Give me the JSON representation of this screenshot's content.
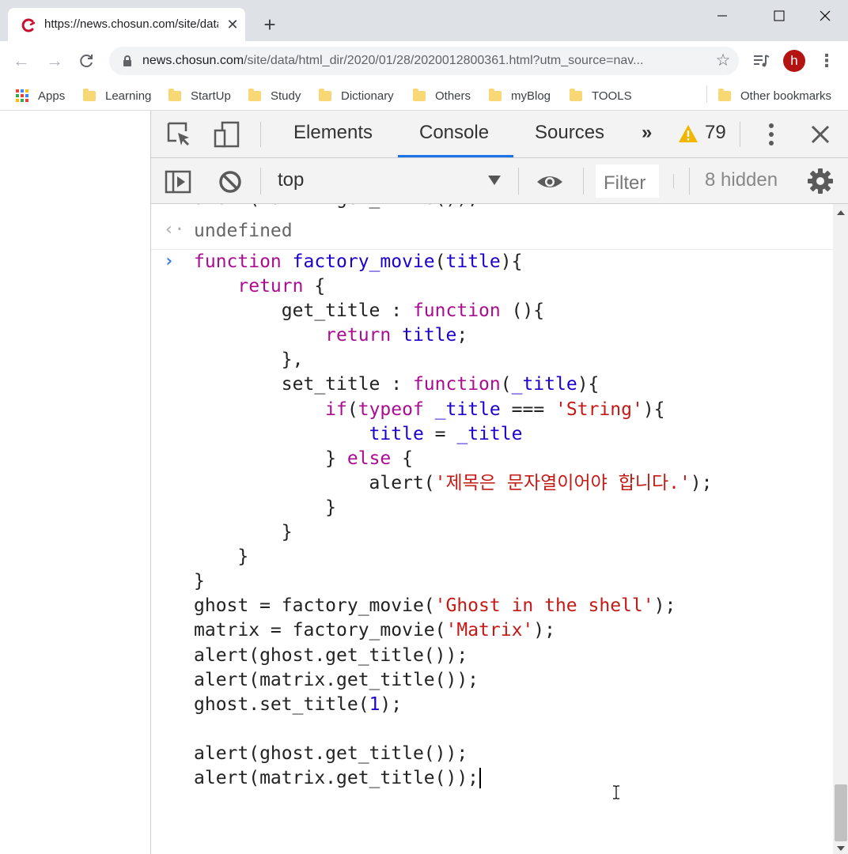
{
  "browser": {
    "tab": {
      "title": "https://news.chosun.com/site/data"
    },
    "omnibox": {
      "host": "news.chosun.com",
      "path": "/site/data/html_dir/2020/01/28/2020012800361.html?utm_source=nav..."
    },
    "profile_initial": "h",
    "bookmarks": [
      {
        "label": "Apps",
        "icon": "apps-grid-icon"
      },
      {
        "label": "Learning",
        "icon": "folder-icon"
      },
      {
        "label": "StartUp",
        "icon": "folder-icon"
      },
      {
        "label": "Study",
        "icon": "folder-icon"
      },
      {
        "label": "Dictionary",
        "icon": "folder-icon"
      },
      {
        "label": "Others",
        "icon": "folder-icon"
      },
      {
        "label": "myBlog",
        "icon": "folder-icon"
      },
      {
        "label": "TOOLS",
        "icon": "folder-icon"
      },
      {
        "label": "Other bookmarks",
        "icon": "folder-icon"
      }
    ]
  },
  "devtools": {
    "tabs": [
      {
        "label": "Elements",
        "active": false
      },
      {
        "label": "Console",
        "active": true
      },
      {
        "label": "Sources",
        "active": false
      }
    ],
    "warning_count": "79",
    "context": "top",
    "filter_placeholder": "Filter",
    "hidden_count": "8 hidden",
    "accent_color": "#1a73e8"
  },
  "console": {
    "partial_line": "alert(matrix.get_title());",
    "previous_result": "undefined",
    "code_lines": [
      [
        {
          "t": "k",
          "x": "function"
        },
        {
          "t": "p",
          "x": " "
        },
        {
          "t": "v",
          "x": "factory_movie"
        },
        {
          "t": "p",
          "x": "("
        },
        {
          "t": "v",
          "x": "title"
        },
        {
          "t": "p",
          "x": "){"
        }
      ],
      [
        {
          "t": "p",
          "x": "    "
        },
        {
          "t": "k",
          "x": "return"
        },
        {
          "t": "p",
          "x": " {"
        }
      ],
      [
        {
          "t": "p",
          "x": "        get_title : "
        },
        {
          "t": "k",
          "x": "function"
        },
        {
          "t": "p",
          "x": " (){"
        }
      ],
      [
        {
          "t": "p",
          "x": "            "
        },
        {
          "t": "k",
          "x": "return"
        },
        {
          "t": "p",
          "x": " "
        },
        {
          "t": "v",
          "x": "title"
        },
        {
          "t": "p",
          "x": ";"
        }
      ],
      [
        {
          "t": "p",
          "x": "        },"
        }
      ],
      [
        {
          "t": "p",
          "x": "        set_title : "
        },
        {
          "t": "k",
          "x": "function"
        },
        {
          "t": "p",
          "x": "("
        },
        {
          "t": "v",
          "x": "_title"
        },
        {
          "t": "p",
          "x": "){"
        }
      ],
      [
        {
          "t": "p",
          "x": "            "
        },
        {
          "t": "k",
          "x": "if"
        },
        {
          "t": "p",
          "x": "("
        },
        {
          "t": "k",
          "x": "typeof"
        },
        {
          "t": "p",
          "x": " "
        },
        {
          "t": "v",
          "x": "_title"
        },
        {
          "t": "p",
          "x": " === "
        },
        {
          "t": "s",
          "x": "'String'"
        },
        {
          "t": "p",
          "x": "){"
        }
      ],
      [
        {
          "t": "p",
          "x": "                "
        },
        {
          "t": "v",
          "x": "title"
        },
        {
          "t": "p",
          "x": " = "
        },
        {
          "t": "v",
          "x": "_title"
        }
      ],
      [
        {
          "t": "p",
          "x": "            } "
        },
        {
          "t": "k",
          "x": "else"
        },
        {
          "t": "p",
          "x": " {"
        }
      ],
      [
        {
          "t": "p",
          "x": "                alert("
        },
        {
          "t": "s",
          "x": "'제목은 문자열이어야 합니다.'"
        },
        {
          "t": "p",
          "x": ");"
        }
      ],
      [
        {
          "t": "p",
          "x": "            }"
        }
      ],
      [
        {
          "t": "p",
          "x": "        }"
        }
      ],
      [
        {
          "t": "p",
          "x": "    }"
        }
      ],
      [
        {
          "t": "p",
          "x": "}"
        }
      ],
      [
        {
          "t": "p",
          "x": "ghost = factory_movie("
        },
        {
          "t": "s",
          "x": "'Ghost in the shell'"
        },
        {
          "t": "p",
          "x": ");"
        }
      ],
      [
        {
          "t": "p",
          "x": "matrix = factory_movie("
        },
        {
          "t": "s",
          "x": "'Matrix'"
        },
        {
          "t": "p",
          "x": ");"
        }
      ],
      [
        {
          "t": "p",
          "x": "alert(ghost.get_title());"
        }
      ],
      [
        {
          "t": "p",
          "x": "alert(matrix.get_title());"
        }
      ],
      [
        {
          "t": "p",
          "x": "ghost.set_title("
        },
        {
          "t": "n",
          "x": "1"
        },
        {
          "t": "p",
          "x": ");"
        }
      ],
      [
        {
          "t": "p",
          "x": ""
        }
      ],
      [
        {
          "t": "p",
          "x": "alert(ghost.get_title());"
        }
      ],
      [
        {
          "t": "p",
          "x": "alert(matrix.get_title());"
        },
        {
          "t": "caret",
          "x": ""
        }
      ]
    ]
  }
}
